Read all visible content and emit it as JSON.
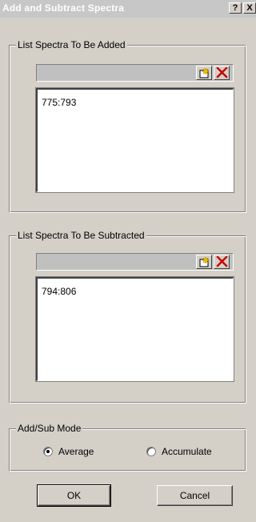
{
  "window": {
    "title": "Add and Subtract Spectra",
    "help_label": "?",
    "close_label": "X"
  },
  "added_group": {
    "legend": "List Spectra To Be Added",
    "new_icon": "new-item-icon",
    "delete_icon": "delete-x-icon",
    "entries": [
      "775:793"
    ]
  },
  "subtracted_group": {
    "legend": "List Spectra To Be Subtracted",
    "new_icon": "new-item-icon",
    "delete_icon": "delete-x-icon",
    "entries": [
      "794:806"
    ]
  },
  "mode_group": {
    "legend": "Add/Sub Mode",
    "options": [
      {
        "label": "Average",
        "selected": true
      },
      {
        "label": "Accumulate",
        "selected": false
      }
    ]
  },
  "buttons": {
    "ok_label": "OK",
    "cancel_label": "Cancel"
  },
  "colors": {
    "face": "#d4d0c8",
    "delete_red": "#cc0000"
  }
}
